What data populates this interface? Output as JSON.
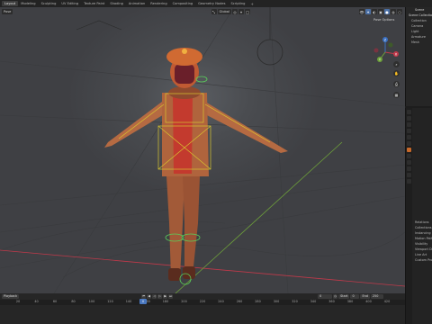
{
  "workspace_tabs": [
    {
      "label": "Layout",
      "active": true
    },
    {
      "label": "Modeling",
      "active": false
    },
    {
      "label": "Sculpting",
      "active": false
    },
    {
      "label": "UV Editing",
      "active": false
    },
    {
      "label": "Texture Paint",
      "active": false
    },
    {
      "label": "Shading",
      "active": false
    },
    {
      "label": "Animation",
      "active": false
    },
    {
      "label": "Rendering",
      "active": false
    },
    {
      "label": "Compositing",
      "active": false
    },
    {
      "label": "Geometry Nodes",
      "active": false
    },
    {
      "label": "Scripting",
      "active": false
    }
  ],
  "workspace_add": "+",
  "scene_label": "Scene",
  "viewport": {
    "mode_label": "Pose",
    "orientation_label": "Global",
    "pose_options_label": "Pose Options",
    "gizmo": {
      "x": "X",
      "y": "Y",
      "z": "Z"
    }
  },
  "outliner": {
    "title": "Scene Collection",
    "items": [
      "Collection",
      "Camera",
      "Light",
      "Armature",
      "Mesh"
    ]
  },
  "properties": {
    "rows": [
      "Relations",
      "Collections",
      "Instancing",
      "Motion Paths",
      "Visibility",
      "Viewport Display",
      "Line Art",
      "Custom Properties"
    ]
  },
  "timeline": {
    "playback_label": "Playback",
    "current_frame": "0",
    "start_label": "Start",
    "start_value": "0",
    "end_label": "End",
    "end_value": "250",
    "ruler_ticks": [
      "20",
      "40",
      "60",
      "80",
      "100",
      "120",
      "140",
      "160",
      "180",
      "200",
      "220",
      "240",
      "260",
      "280",
      "300",
      "320",
      "340",
      "360",
      "380",
      "400",
      "420"
    ],
    "playhead_frame": "0"
  },
  "colors": {
    "accent_blue": "#4a78c0",
    "bone_yellow": "#d8c52f",
    "axis_red": "#c0394a",
    "axis_green": "#6ea13a"
  }
}
